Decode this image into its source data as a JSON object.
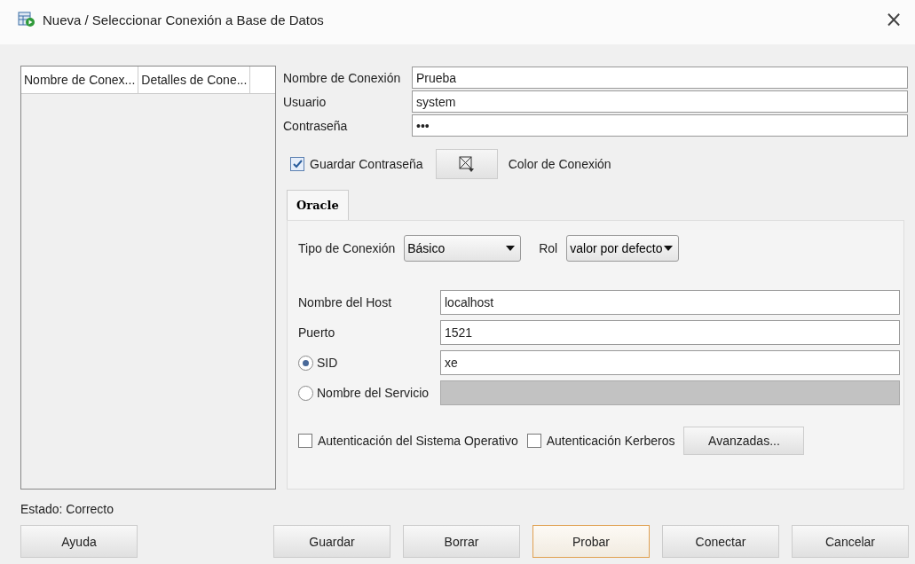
{
  "window": {
    "title": "Nueva / Seleccionar Conexión a Base de Datos",
    "close": "×"
  },
  "connections_table": {
    "columns": [
      "Nombre de Conex...",
      "Detalles de Cone..."
    ]
  },
  "fields": [
    {
      "label": "Nombre de Conexión",
      "value": "Prueba"
    },
    {
      "label": "Usuario",
      "value": "system"
    },
    {
      "label": "Contraseña",
      "value": "•••"
    }
  ],
  "save_password": {
    "label": "Guardar Contraseña",
    "checked": true
  },
  "color_button": {
    "label": "Color de Conexión"
  },
  "tabs": [
    {
      "label": "Oracle",
      "selected": true
    }
  ],
  "oracle": {
    "connection_type": {
      "label": "Tipo de Conexión",
      "value": "Básico"
    },
    "role": {
      "label": "Rol",
      "value": "valor por defecto"
    },
    "fields": [
      {
        "kind": "text",
        "label": "Nombre del Host",
        "value": "localhost",
        "disabled": false
      },
      {
        "kind": "text",
        "label": "Puerto",
        "value": "1521",
        "disabled": false
      },
      {
        "kind": "radio",
        "label": "SID",
        "value": "xe",
        "selected": true,
        "disabled": false
      },
      {
        "kind": "radio",
        "label": "Nombre del Servicio",
        "selected": false,
        "disabled": true
      }
    ],
    "options": [
      {
        "label": "Autenticación del Sistema Operativo",
        "checked": false
      },
      {
        "label": "Autenticación Kerberos",
        "checked": false
      }
    ],
    "advanced_button": "Avanzadas..."
  },
  "status": "Estado: Correcto",
  "buttons": [
    {
      "label": "Ayuda",
      "focused": false
    },
    {
      "label": "Guardar",
      "focused": false
    },
    {
      "label": "Borrar",
      "focused": false
    },
    {
      "label": "Probar",
      "focused": true
    },
    {
      "label": "Conectar",
      "focused": false
    },
    {
      "label": "Cancelar",
      "focused": false
    }
  ]
}
